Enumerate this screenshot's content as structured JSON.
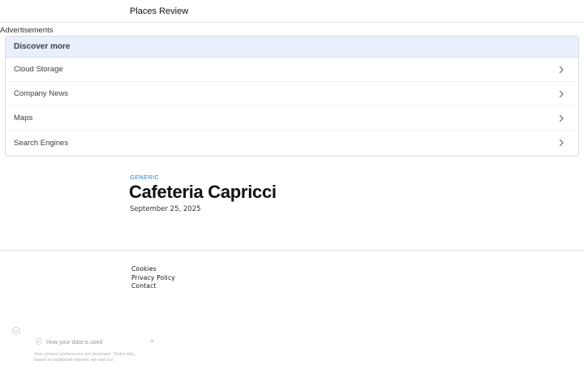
{
  "header": {
    "site_title": "Places Review"
  },
  "ads": {
    "label": "Advertisements"
  },
  "discover": {
    "heading": "Discover more",
    "items": [
      {
        "label": "Cloud Storage",
        "icon": "chevron-right-icon"
      },
      {
        "label": "Company News",
        "icon": "chevron-right-icon"
      },
      {
        "label": "Maps",
        "icon": "chevron-right-icon"
      },
      {
        "label": "Search Engines",
        "icon": "chevron-right-icon"
      }
    ]
  },
  "post": {
    "category": "GENERIC",
    "title": "Cafeteria Capricci",
    "date": "September 25, 2025"
  },
  "footer": {
    "links": [
      "Cookies",
      "Privacy Policy",
      "Contact"
    ]
  },
  "consent": {
    "title": "How your data is used",
    "close": "×",
    "text": "Your privacy preferences are important. That's why, based on legitimate interest, we and our"
  },
  "colors": {
    "accent": "#2a7fc1",
    "discover_header_bg": "#e8f0fe",
    "border": "#dadce0"
  }
}
